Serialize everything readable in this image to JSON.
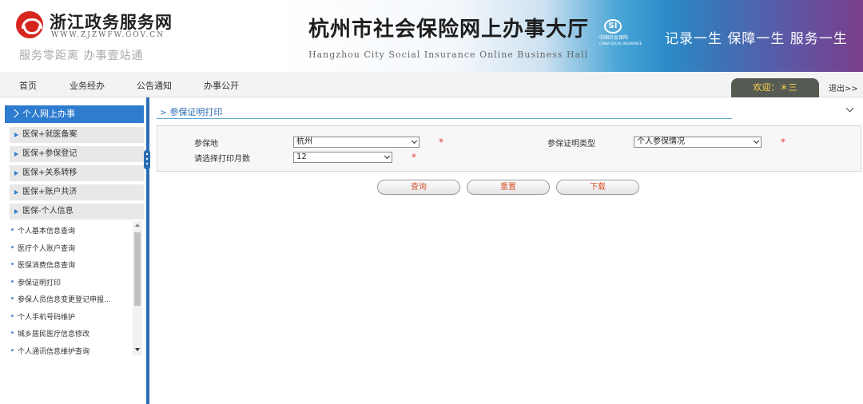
{
  "header": {
    "logo_title": "浙江政务服务网",
    "logo_url": "WWW.ZJZWFW.GOV.CN",
    "logo_slogan": "服务零距离 办事壹站通",
    "banner_title": "杭州市社会保险网上办事大厅",
    "banner_subtitle": "Hangzhou City Social Insurance Online Business Hall",
    "si_logo_text": "中国社会保险",
    "si_logo_en": "CHINA SOCIAL INSURANCE",
    "banner_slogan": "记录一生 保障一生 服务一生"
  },
  "nav": {
    "items": [
      "首页",
      "业务经办",
      "公告通知",
      "办事公开"
    ],
    "welcome": "欢迎：＊三",
    "logout": "退出>>"
  },
  "sidebar": {
    "header": "个人网上办事",
    "groups": [
      "医保+就医备案",
      "医保+参保登记",
      "医保+关系转移",
      "医保+账户共济",
      "医保-个人信息"
    ],
    "links": [
      "个人基本信息查询",
      "医疗个人账户查询",
      "医保消费信息查询",
      "参保证明打印",
      "参保人员信息变更登记申报...",
      "个人手机号码维护",
      "城乡居民医疗信息修改",
      "个人通讯信息维护查询"
    ]
  },
  "main": {
    "title": "参保证明打印",
    "form": {
      "place_label": "参保地",
      "place_value": "杭州",
      "cert_type_label": "参保证明类型",
      "cert_type_value": "个人参保情况",
      "months_label": "请选择打印月数",
      "months_value": "12",
      "required_mark": "*"
    },
    "buttons": [
      "查询",
      "重置",
      "下载"
    ]
  },
  "colors": {
    "primary_blue": "#2d7ccf",
    "sidebar_border": "#2a6fb6",
    "required_red": "#e23c3c",
    "button_text": "#d9532c",
    "welcome_text": "#ffd34d"
  }
}
